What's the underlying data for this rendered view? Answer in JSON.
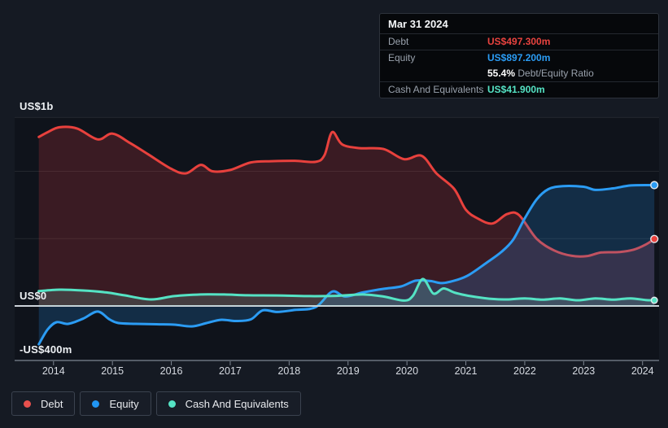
{
  "tooltip": {
    "date": "Mar 31 2024",
    "debt_label": "Debt",
    "debt_value": "US$497.300m",
    "equity_label": "Equity",
    "equity_value": "US$897.200m",
    "ratio_value": "55.4%",
    "ratio_text": "Debt/Equity Ratio",
    "cash_label": "Cash And Equivalents",
    "cash_value": "US$41.900m"
  },
  "y_axis": {
    "top_label": "US$1b",
    "zero_label": "US$0",
    "bottom_label": "-US$400m"
  },
  "x_axis": {
    "years": [
      "2014",
      "2015",
      "2016",
      "2017",
      "2018",
      "2019",
      "2020",
      "2021",
      "2022",
      "2023",
      "2024"
    ]
  },
  "legend": {
    "items": [
      {
        "label": "Debt",
        "color": "#e8504d"
      },
      {
        "label": "Equity",
        "color": "#2196f3"
      },
      {
        "label": "Cash And Equivalents",
        "color": "#55e3c4"
      }
    ]
  },
  "colors": {
    "page_bg": "#151a23",
    "plot_bg": "#0f131b",
    "gridline": "rgba(255,255,255,0.085)",
    "zero_line": "#ccd2d9",
    "axis_line": "#7e8692",
    "debt": "#e8413d",
    "equity": "#2b9cf4",
    "cash": "#55e3c4",
    "debt_fill": "rgba(228,60,70,0.20)",
    "equity_fill": "rgba(33,150,243,0.20)",
    "cash_fill": "rgba(120,230,205,0.17)",
    "dot_ring": "#e4e8ec"
  },
  "chart_data": {
    "type": "area",
    "title": "Debt to Equity History (hover tooltip: Mar 31 2024)",
    "unit": "US$ millions",
    "xlim": [
      2013.34,
      2024.28
    ],
    "ylim": [
      -405,
      1402
    ],
    "gridline_values": [
      1400,
      1000,
      500
    ],
    "zero_value": 0,
    "legend_position": "bottom-left",
    "series": [
      {
        "name": "Debt",
        "points": [
          [
            2013.75,
            1255
          ],
          [
            2013.9,
            1290
          ],
          [
            2014.1,
            1327
          ],
          [
            2014.4,
            1318
          ],
          [
            2014.75,
            1237
          ],
          [
            2015.0,
            1280
          ],
          [
            2015.3,
            1210
          ],
          [
            2015.6,
            1128
          ],
          [
            2016.0,
            1018
          ],
          [
            2016.25,
            985
          ],
          [
            2016.5,
            1048
          ],
          [
            2016.7,
            1000
          ],
          [
            2017.0,
            1010
          ],
          [
            2017.35,
            1066
          ],
          [
            2017.7,
            1075
          ],
          [
            2018.1,
            1078
          ],
          [
            2018.45,
            1070
          ],
          [
            2018.6,
            1120
          ],
          [
            2018.73,
            1291
          ],
          [
            2018.9,
            1200
          ],
          [
            2019.2,
            1172
          ],
          [
            2019.6,
            1166
          ],
          [
            2019.95,
            1090
          ],
          [
            2020.25,
            1115
          ],
          [
            2020.5,
            985
          ],
          [
            2020.8,
            870
          ],
          [
            2021.0,
            715
          ],
          [
            2021.2,
            650
          ],
          [
            2021.45,
            612
          ],
          [
            2021.7,
            682
          ],
          [
            2021.9,
            676
          ],
          [
            2022.2,
            500
          ],
          [
            2022.5,
            412
          ],
          [
            2022.8,
            372
          ],
          [
            2023.05,
            370
          ],
          [
            2023.3,
            397
          ],
          [
            2023.6,
            400
          ],
          [
            2023.85,
            418
          ],
          [
            2024.05,
            455
          ],
          [
            2024.2,
            497.3
          ]
        ]
      },
      {
        "name": "Equity",
        "points": [
          [
            2013.75,
            -285
          ],
          [
            2013.9,
            -175
          ],
          [
            2014.05,
            -121
          ],
          [
            2014.25,
            -133
          ],
          [
            2014.5,
            -95
          ],
          [
            2014.75,
            -42
          ],
          [
            2014.95,
            -100
          ],
          [
            2015.1,
            -127
          ],
          [
            2015.4,
            -133
          ],
          [
            2015.75,
            -136
          ],
          [
            2016.05,
            -139
          ],
          [
            2016.35,
            -152
          ],
          [
            2016.6,
            -127
          ],
          [
            2016.85,
            -103
          ],
          [
            2017.1,
            -112
          ],
          [
            2017.35,
            -100
          ],
          [
            2017.55,
            -33
          ],
          [
            2017.8,
            -45
          ],
          [
            2018.1,
            -30
          ],
          [
            2018.45,
            -9
          ],
          [
            2018.73,
            106
          ],
          [
            2018.95,
            70
          ],
          [
            2019.25,
            100
          ],
          [
            2019.6,
            127
          ],
          [
            2019.9,
            145
          ],
          [
            2020.15,
            188
          ],
          [
            2020.4,
            185
          ],
          [
            2020.6,
            170
          ],
          [
            2020.85,
            194
          ],
          [
            2021.05,
            230
          ],
          [
            2021.35,
            320
          ],
          [
            2021.6,
            400
          ],
          [
            2021.8,
            490
          ],
          [
            2022.0,
            650
          ],
          [
            2022.2,
            790
          ],
          [
            2022.4,
            867
          ],
          [
            2022.65,
            890
          ],
          [
            2023.0,
            885
          ],
          [
            2023.2,
            862
          ],
          [
            2023.5,
            873
          ],
          [
            2023.8,
            895
          ],
          [
            2024.2,
            897.2
          ]
        ]
      },
      {
        "name": "Cash And Equivalents",
        "points": [
          [
            2013.75,
            110
          ],
          [
            2014.1,
            121
          ],
          [
            2014.5,
            115
          ],
          [
            2014.9,
            100
          ],
          [
            2015.2,
            79
          ],
          [
            2015.65,
            48
          ],
          [
            2016.05,
            73
          ],
          [
            2016.5,
            85
          ],
          [
            2016.9,
            85
          ],
          [
            2017.3,
            79
          ],
          [
            2017.8,
            78
          ],
          [
            2018.3,
            73
          ],
          [
            2018.8,
            75
          ],
          [
            2019.25,
            85
          ],
          [
            2019.6,
            70
          ],
          [
            2019.95,
            40
          ],
          [
            2020.1,
            75
          ],
          [
            2020.27,
            200
          ],
          [
            2020.45,
            92
          ],
          [
            2020.62,
            130
          ],
          [
            2020.8,
            100
          ],
          [
            2021.0,
            79
          ],
          [
            2021.2,
            65
          ],
          [
            2021.45,
            52
          ],
          [
            2021.7,
            48
          ],
          [
            2022.0,
            56
          ],
          [
            2022.3,
            47
          ],
          [
            2022.6,
            56
          ],
          [
            2022.9,
            42
          ],
          [
            2023.2,
            56
          ],
          [
            2023.5,
            47
          ],
          [
            2023.8,
            56
          ],
          [
            2024.05,
            44
          ],
          [
            2024.2,
            41.9
          ]
        ]
      }
    ]
  }
}
